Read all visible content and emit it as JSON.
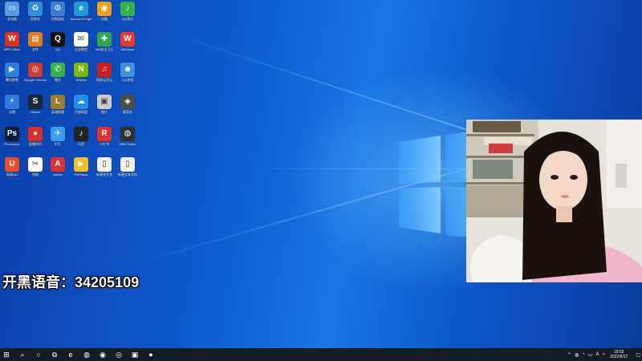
{
  "overlay": {
    "text": "开黑语音：34205109"
  },
  "desktop": {
    "icons": [
      {
        "label": "此电脑",
        "color": "#5a9be0",
        "glyph": "▭"
      },
      {
        "label": "回收站",
        "color": "#2f8fd8",
        "glyph": "♻"
      },
      {
        "label": "控制面板",
        "color": "#3b7fd4",
        "glyph": "⚙"
      },
      {
        "label": "Microsoft Edge",
        "color": "#1a9ad6",
        "glyph": "e"
      },
      {
        "label": "优酷",
        "color": "#e8a21a",
        "glyph": "◉"
      },
      {
        "label": "QQ音乐",
        "color": "#2fb34a",
        "glyph": "♪"
      },
      {
        "label": "WPS Office",
        "color": "#d93025",
        "glyph": "W"
      },
      {
        "label": "文件",
        "color": "#e07b1a",
        "glyph": "▤"
      },
      {
        "label": "QQ",
        "color": "#111111",
        "glyph": "Q"
      },
      {
        "label": "企业微信",
        "color": "#ffffff",
        "glyph": "✉"
      },
      {
        "label": "360安全卫士",
        "color": "#2fa84f",
        "glyph": "✚"
      },
      {
        "label": "WeGame",
        "color": "#e23a2e",
        "glyph": "W"
      },
      {
        "label": "腾讯视频",
        "color": "#2b7de0",
        "glyph": "▶"
      },
      {
        "label": "Google Chrome",
        "color": "#d03b2f",
        "glyph": "◎"
      },
      {
        "label": "微信",
        "color": "#36b24a",
        "glyph": "✆"
      },
      {
        "label": "NVIDIA",
        "color": "#76b900",
        "glyph": "N"
      },
      {
        "label": "网易云音乐",
        "color": "#c81e1e",
        "glyph": "♫"
      },
      {
        "label": "QQ游戏",
        "color": "#3f8fe0",
        "glyph": "☻"
      },
      {
        "label": "迅雷",
        "color": "#2f7ae0",
        "glyph": "⚡"
      },
      {
        "label": "Steam",
        "color": "#1b2838",
        "glyph": "S"
      },
      {
        "label": "英雄联盟",
        "color": "#a07a2a",
        "glyph": "L"
      },
      {
        "label": "百度网盘",
        "color": "#1f8ef0",
        "glyph": "☁"
      },
      {
        "label": "图片",
        "color": "#cccccc",
        "glyph": "▣"
      },
      {
        "label": "爱奇艺",
        "color": "#4c4c4c",
        "glyph": "◈"
      },
      {
        "label": "Photoshop",
        "color": "#0c1e3a",
        "glyph": "Ps"
      },
      {
        "label": "直播伴侣",
        "color": "#d92d2d",
        "glyph": "●"
      },
      {
        "label": "钉钉",
        "color": "#3a9cf0",
        "glyph": "✈"
      },
      {
        "label": "抖音",
        "color": "#222222",
        "glyph": "♪"
      },
      {
        "label": "小红书",
        "color": "#e0322b",
        "glyph": "R"
      },
      {
        "label": "OBS Studio",
        "color": "#303030",
        "glyph": "◍"
      },
      {
        "label": "网易UU",
        "color": "#e94f2a",
        "glyph": "U"
      },
      {
        "label": "剪映",
        "color": "#ffffff",
        "glyph": "✂"
      },
      {
        "label": "Adobe",
        "color": "#e03030",
        "glyph": "A"
      },
      {
        "label": "PotPlayer",
        "color": "#f0c020",
        "glyph": "▶"
      },
      {
        "label": "新建文件夹",
        "color": "#f0f0f0",
        "glyph": "▯"
      },
      {
        "label": "新建文本文档",
        "color": "#f0f0f0",
        "glyph": "▯"
      }
    ]
  },
  "taskbar": {
    "items": [
      {
        "name": "start",
        "glyph": "⊞"
      },
      {
        "name": "search",
        "glyph": "⌕"
      },
      {
        "name": "cortana",
        "glyph": "○"
      },
      {
        "name": "task-view",
        "glyph": "⧉"
      },
      {
        "name": "edge",
        "glyph": "e"
      },
      {
        "name": "wechat",
        "glyph": "◍"
      },
      {
        "name": "browser",
        "glyph": "◉"
      },
      {
        "name": "obs",
        "glyph": "◎"
      },
      {
        "name": "app",
        "glyph": "▣"
      },
      {
        "name": "potplayer",
        "glyph": "●"
      }
    ],
    "tray": {
      "lang": "A",
      "time": "19:52",
      "date": "2022/6/17"
    }
  },
  "colors": {
    "taskbar": "#161c24",
    "desktop": "#0f5ad0",
    "webcam_wall": "#e8e6e1"
  }
}
